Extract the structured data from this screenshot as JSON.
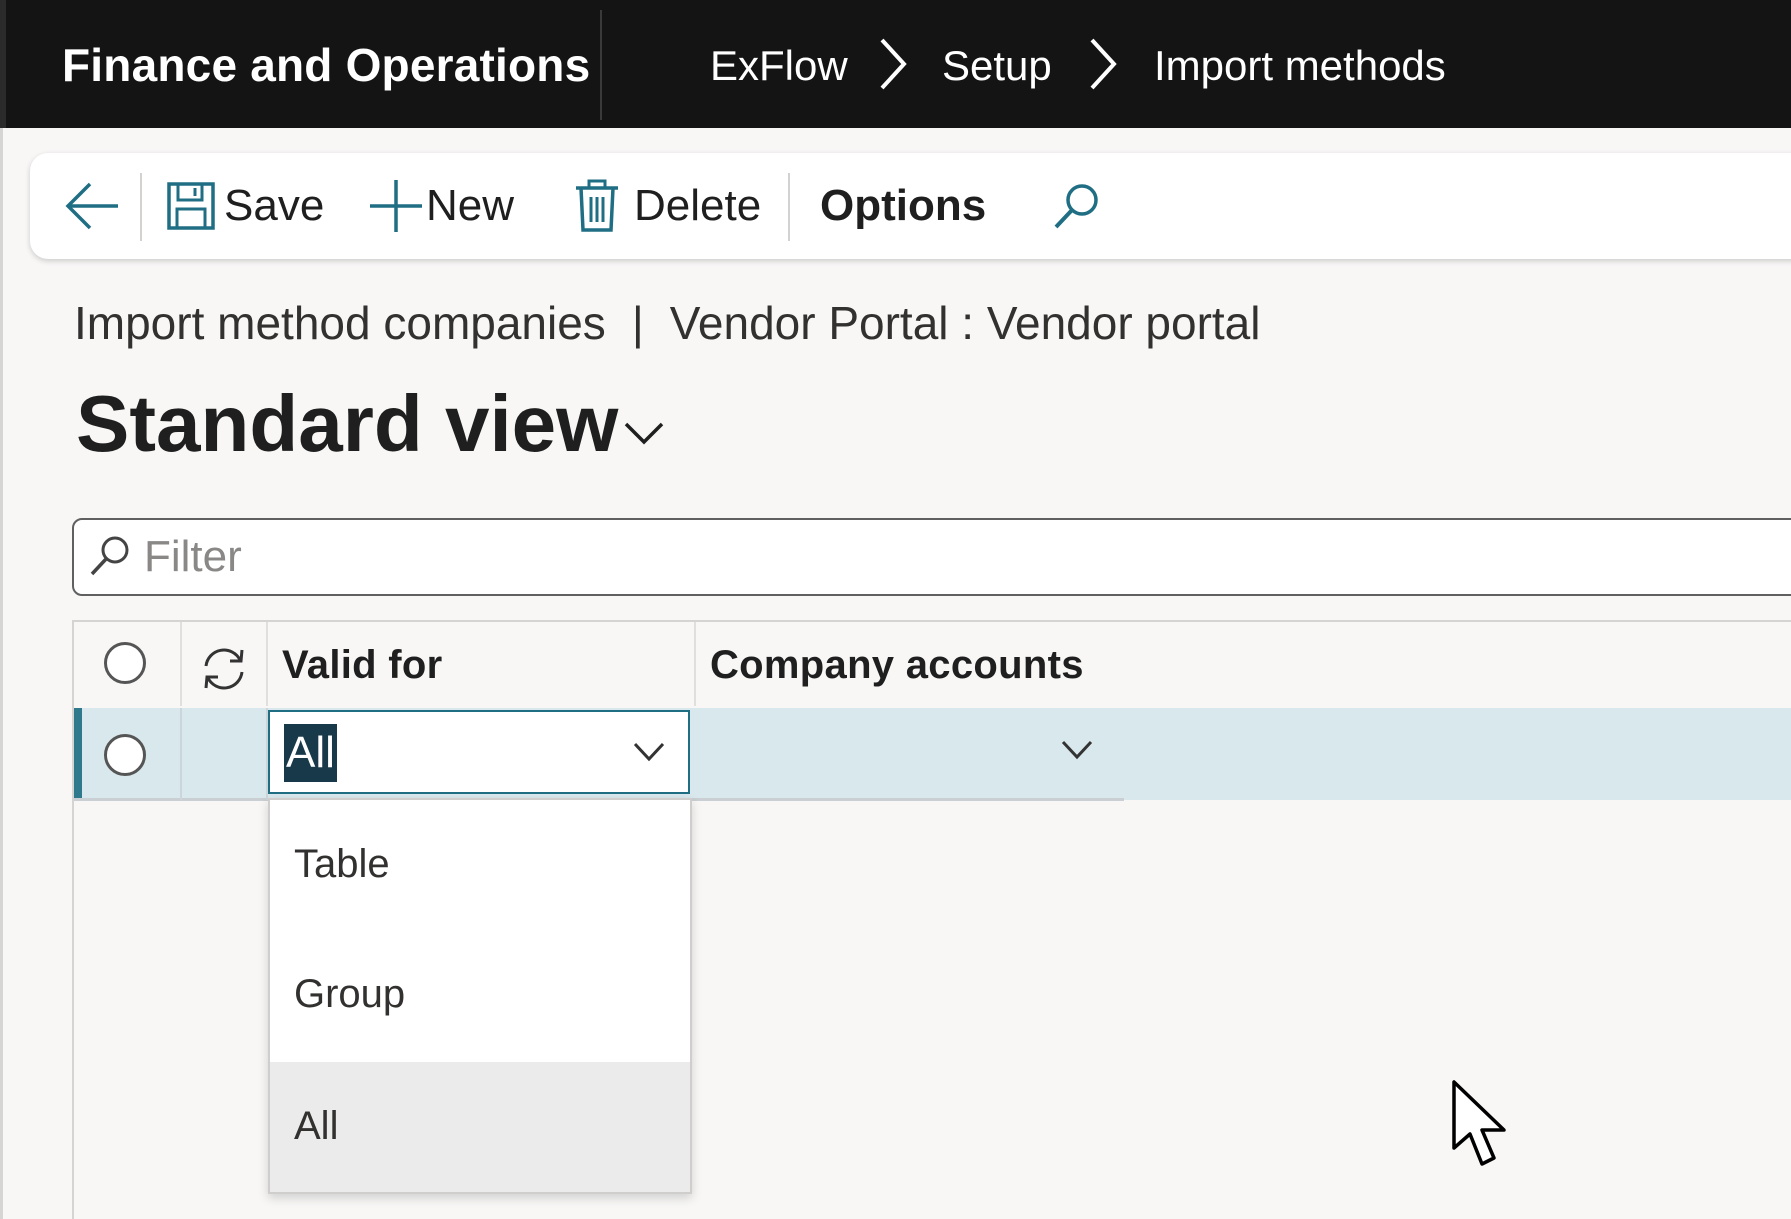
{
  "app": {
    "title": "Finance and Operations"
  },
  "breadcrumb": [
    "ExFlow",
    "Setup",
    "Import methods"
  ],
  "toolbar": {
    "save_label": "Save",
    "new_label": "New",
    "delete_label": "Delete",
    "options_label": "Options"
  },
  "caption": {
    "left": "Import method companies",
    "separator": "|",
    "right": "Vendor Portal : Vendor portal"
  },
  "view": {
    "title": "Standard view"
  },
  "filter": {
    "placeholder": "Filter",
    "value": ""
  },
  "grid": {
    "columns": [
      "Valid for",
      "Company accounts"
    ],
    "rows": [
      {
        "valid_for": "All",
        "company_accounts": ""
      }
    ]
  },
  "dropdown": {
    "options": [
      "Table",
      "Group",
      "All"
    ],
    "selected": "All"
  },
  "colors": {
    "topbar": "#141414",
    "accent": "#2e7a8c",
    "row_selected": "#d8e8ec"
  }
}
